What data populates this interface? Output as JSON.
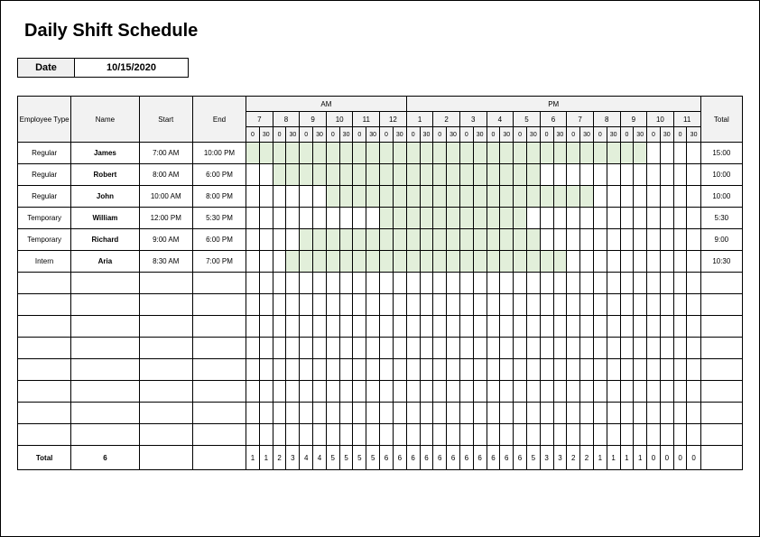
{
  "title": "Daily Shift Schedule",
  "date_label": "Date",
  "date_value": "10/15/2020",
  "headers": {
    "employee_type": "Employee Type",
    "name": "Name",
    "start": "Start",
    "end": "End",
    "am": "AM",
    "pm": "PM",
    "total": "Total"
  },
  "hours": [
    "7",
    "8",
    "9",
    "10",
    "11",
    "12",
    "1",
    "2",
    "3",
    "4",
    "5",
    "6",
    "7",
    "8",
    "9",
    "10",
    "11"
  ],
  "halves": [
    "0",
    "30"
  ],
  "rows": [
    {
      "type": "Regular",
      "name": "James",
      "start": "7:00 AM",
      "end": "10:00 PM",
      "total": "15:00",
      "s": 0,
      "e": 30
    },
    {
      "type": "Regular",
      "name": "Robert",
      "start": "8:00 AM",
      "end": "6:00 PM",
      "total": "10:00",
      "s": 2,
      "e": 22
    },
    {
      "type": "Regular",
      "name": "John",
      "start": "10:00 AM",
      "end": "8:00 PM",
      "total": "10:00",
      "s": 6,
      "e": 26
    },
    {
      "type": "Temporary",
      "name": "William",
      "start": "12:00 PM",
      "end": "5:30 PM",
      "total": "5:30",
      "s": 10,
      "e": 21
    },
    {
      "type": "Temporary",
      "name": "Richard",
      "start": "9:00 AM",
      "end": "6:00 PM",
      "total": "9:00",
      "s": 4,
      "e": 22
    },
    {
      "type": "Intern",
      "name": "Aria",
      "start": "8:30 AM",
      "end": "7:00 PM",
      "total": "10:30",
      "s": 3,
      "e": 24
    }
  ],
  "empty_rows": 8,
  "footer": {
    "label": "Total",
    "count": "6",
    "col_totals": [
      "1",
      "1",
      "2",
      "3",
      "4",
      "4",
      "5",
      "5",
      "5",
      "5",
      "6",
      "6",
      "6",
      "6",
      "6",
      "6",
      "6",
      "6",
      "6",
      "6",
      "6",
      "5",
      "3",
      "3",
      "2",
      "2",
      "1",
      "1",
      "1",
      "1",
      "0",
      "0",
      "0",
      "0"
    ],
    "total": ""
  },
  "chart_data": {
    "type": "table",
    "title": "Daily Shift Schedule",
    "date": "10/15/2020",
    "columns": [
      "Employee Type",
      "Name",
      "Start",
      "End",
      "Total"
    ],
    "rows": [
      [
        "Regular",
        "James",
        "7:00 AM",
        "10:00 PM",
        "15:00"
      ],
      [
        "Regular",
        "Robert",
        "8:00 AM",
        "6:00 PM",
        "10:00"
      ],
      [
        "Regular",
        "John",
        "10:00 AM",
        "8:00 PM",
        "10:00"
      ],
      [
        "Temporary",
        "William",
        "12:00 PM",
        "5:30 PM",
        "5:30"
      ],
      [
        "Temporary",
        "Richard",
        "9:00 AM",
        "6:00 PM",
        "9:00"
      ],
      [
        "Intern",
        "Aria",
        "8:30 AM",
        "7:00 PM",
        "10:30"
      ]
    ],
    "half_hour_totals": [
      1,
      1,
      2,
      3,
      4,
      4,
      5,
      5,
      5,
      5,
      6,
      6,
      6,
      6,
      6,
      6,
      6,
      6,
      6,
      6,
      6,
      5,
      3,
      3,
      2,
      2,
      1,
      1,
      1,
      1,
      0,
      0,
      0,
      0
    ],
    "employee_count": 6
  }
}
